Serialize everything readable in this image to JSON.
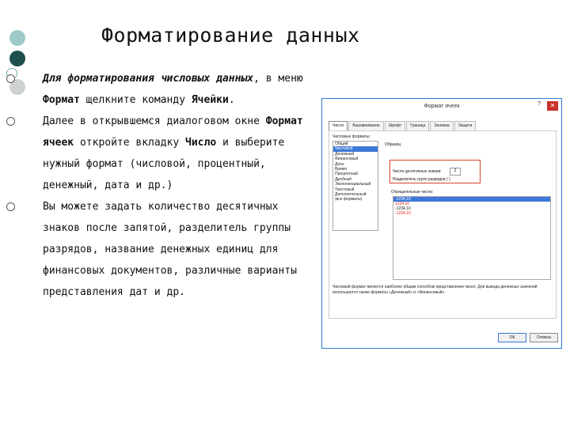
{
  "title": "Форматирование данных",
  "bullets": {
    "b1": {
      "p1": "Для форматирования числовых данных",
      "p2": ", в меню ",
      "p3": "Формат",
      "p4": " щелкните команду ",
      "p5": "Ячейки",
      "p6": "."
    },
    "b2": {
      "p1": "Далее в открывшемся диалоговом окне ",
      "p2": "Формат ячеек",
      "p3": " откройте вкладку ",
      "p4": "Число",
      "p5": " и выберите нужный формат (числовой, процентный, денежный, дата и др.)"
    },
    "b3": {
      "p1": "Вы можете задать количество десятичных знаков после запятой, разделитель группы разрядов, название денежных единиц для финансовых документов, различные варианты представления дат и др."
    }
  },
  "dialog": {
    "title": "Формат ячеек",
    "help": "?",
    "close": "✕",
    "tabs": [
      "Число",
      "Выравнивание",
      "Шрифт",
      "Граница",
      "Заливка",
      "Защита"
    ],
    "category_label": "Числовые форматы:",
    "categories": [
      "Общий",
      "Числовой",
      "Денежный",
      "Финансовый",
      "Дата",
      "Время",
      "Процентный",
      "Дробный",
      "Экспоненциальный",
      "Текстовый",
      "Дополнительный",
      "(все форматы)"
    ],
    "selected_category": "Числовой",
    "sample_label": "Образец",
    "decimal_label": "Число десятичных знаков:",
    "decimal_value": "2",
    "separator_label": "Разделитель групп разрядов ( )",
    "negative_label": "Отрицательные числа:",
    "negative_items": [
      "-1234,10",
      "1234,10",
      "-1234,10",
      "-1234,10"
    ],
    "description": "Числовой формат является наиболее общим способом представления чисел. Для вывода денежных значений используются также форматы «Денежный» и «Финансовый».",
    "ok_label": "ОК",
    "cancel_label": "Отмена"
  }
}
